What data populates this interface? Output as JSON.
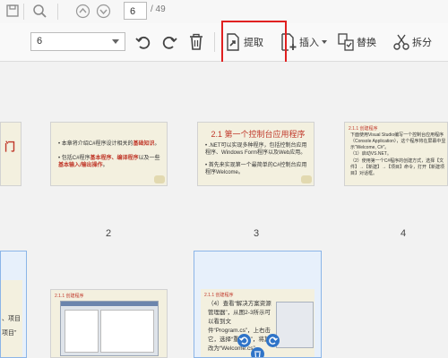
{
  "nav": {
    "current_page": "6",
    "total_pages": "/ 49",
    "icons": [
      "save-icon",
      "search-icon",
      "page-up-icon",
      "page-down-icon"
    ]
  },
  "toolbar": {
    "zoom_value": "6",
    "extract_label": "提取",
    "insert_label": "插入",
    "replace_label": "替换",
    "split_label": "拆分",
    "icons": [
      "undo-icon",
      "redo-icon",
      "delete-icon",
      "extract-icon",
      "insert-icon",
      "replace-icon",
      "split-icon"
    ],
    "highlight_color": "#e02020"
  },
  "pages": {
    "labels": [
      "2",
      "3",
      "4"
    ],
    "thumb1_text": "门",
    "thumb2_line1a": "本章将介绍C#程序设计相关的",
    "thumb2_line1b": "基础知识",
    "thumb2_line2a": "包括C#程序",
    "thumb2_line2b": "基本程序、编译程序",
    "thumb2_line2c": "以及一些",
    "thumb2_line2d": "基本输入/输出操作",
    "thumb3_title": "2.1 第一个控制台应用程序",
    "thumb3_line1": ".NET可以实现多种程序，包括控制台应用程序、Windows Form程序以及Web应用。",
    "thumb3_line2": "首先来实现第一个最简单的C#控制台应用程序Welcome。",
    "thumb4_head": "2.1.1 创建程序",
    "thumb4_line1": "下面使用Visual Studio编写一个控制台应用程序（Console Application），这个程序将在屏幕中显示“Welcome, C#”。",
    "thumb4_line2": "（1）启动VS.NET。",
    "thumb4_line3": "（2）使用第一个C#程序的创建方式，选择【文件】→【新建】→【项目】命令，打开【新建项目】对话框。",
    "thumb5_text1": "、项目",
    "thumb5_text2": "项目”",
    "thumb6_head": "2.1.1 创建程序",
    "thumb7_head": "2.1.1 创建程序",
    "thumb7_line1": "（4）查看“解决方案资源管理器”，从图2-3所示可以看到文件“Program.cs”，上右击它，选择“重命名”，将其改为“Welcome.cs”。"
  },
  "colors": {
    "slide_bg": "#f3f0df",
    "accent_red": "#c0392b",
    "selection_blue": "#8bb5e8"
  }
}
